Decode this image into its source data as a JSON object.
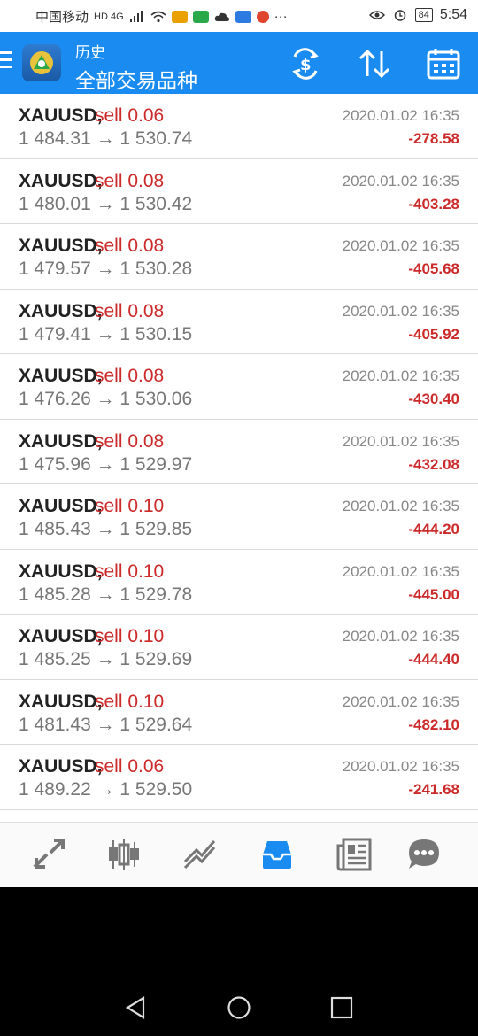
{
  "status_bar": {
    "carrier": "中国移动",
    "network": "HD 4G",
    "battery": "84",
    "time": "5:54",
    "more": "···"
  },
  "app_bar": {
    "title_small": "历史",
    "title_big": "全部交易品种",
    "actions": [
      "currency-exchange-icon",
      "sort-icon",
      "calendar-icon"
    ]
  },
  "trades": [
    {
      "symbol": "XAUUSD,",
      "side": "sell 0.06",
      "prices": "1 484.31 → 1 530.74",
      "date": "2020.01.02 16:35",
      "profit": "-278.58"
    },
    {
      "symbol": "XAUUSD,",
      "side": "sell 0.08",
      "prices": "1 480.01 → 1 530.42",
      "date": "2020.01.02 16:35",
      "profit": "-403.28"
    },
    {
      "symbol": "XAUUSD,",
      "side": "sell 0.08",
      "prices": "1 479.57 → 1 530.28",
      "date": "2020.01.02 16:35",
      "profit": "-405.68"
    },
    {
      "symbol": "XAUUSD,",
      "side": "sell 0.08",
      "prices": "1 479.41 → 1 530.15",
      "date": "2020.01.02 16:35",
      "profit": "-405.92"
    },
    {
      "symbol": "XAUUSD,",
      "side": "sell 0.08",
      "prices": "1 476.26 → 1 530.06",
      "date": "2020.01.02 16:35",
      "profit": "-430.40"
    },
    {
      "symbol": "XAUUSD,",
      "side": "sell 0.08",
      "prices": "1 475.96 → 1 529.97",
      "date": "2020.01.02 16:35",
      "profit": "-432.08"
    },
    {
      "symbol": "XAUUSD,",
      "side": "sell 0.10",
      "prices": "1 485.43 → 1 529.85",
      "date": "2020.01.02 16:35",
      "profit": "-444.20"
    },
    {
      "symbol": "XAUUSD,",
      "side": "sell 0.10",
      "prices": "1 485.28 → 1 529.78",
      "date": "2020.01.02 16:35",
      "profit": "-445.00"
    },
    {
      "symbol": "XAUUSD,",
      "side": "sell 0.10",
      "prices": "1 485.25 → 1 529.69",
      "date": "2020.01.02 16:35",
      "profit": "-444.40"
    },
    {
      "symbol": "XAUUSD,",
      "side": "sell 0.10",
      "prices": "1 481.43 → 1 529.64",
      "date": "2020.01.02 16:35",
      "profit": "-482.10"
    },
    {
      "symbol": "XAUUSD,",
      "side": "sell 0.06",
      "prices": "1 489.22 → 1 529.50",
      "date": "2020.01.02 16:35",
      "profit": "-241.68"
    }
  ],
  "tabs": [
    "quotes-icon",
    "chart-icon",
    "trade-icon",
    "history-icon",
    "news-icon",
    "chat-icon"
  ],
  "colors": {
    "primary": "#1a8bf0",
    "loss": "#cc2a2a",
    "active_tab": "#1a8bf0",
    "inactive_tab": "#777777"
  }
}
